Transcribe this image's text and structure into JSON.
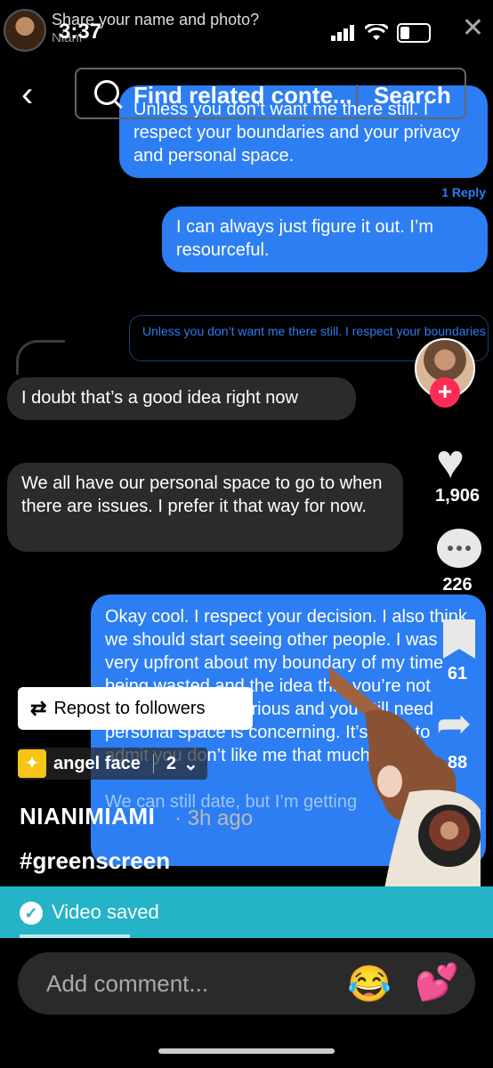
{
  "status": {
    "share_prompt": "Share your name and photo?",
    "name": "Niani",
    "time": "3:37",
    "close": "✕"
  },
  "search": {
    "back": "‹",
    "placeholder": "Find related conte...",
    "button": "Search"
  },
  "messages": {
    "m1": "Unless you don’t want me there still. I respect your boundaries and your privacy and personal space.",
    "reply_count": "1 Reply",
    "m2": "I can always just figure it out. I’m resourceful.",
    "quoted": "Unless you don’t want me there still. I respect your boundaries and your privacy and personal space.",
    "m3": "I doubt that’s a good idea right now",
    "m4": "We all have our personal space to go to when there are issues. I prefer it that way for now.",
    "m5": "Okay cool. I respect your decision. I also think we should start seeing other people. I was very upfront about my boundary of my time being wasted and the idea that you’re not really taking life serious and you still need personal space is concerning. It’s okay to admit you don’t like me that much.",
    "m6": "We can still date, but I’m getting"
  },
  "rail": {
    "follow": "+",
    "likes": "1,906",
    "comments": "226",
    "saves": "61",
    "shares": "88"
  },
  "overlay": {
    "repost_icon": "⇄",
    "repost": "Repost to followers",
    "effect_name": "angel face",
    "effect_count": "2",
    "chevron": "⌄",
    "username": "NIANIMIAMI",
    "time_ago": "· 3h ago",
    "hashtag": "#greenscreen"
  },
  "toast": {
    "check": "✓",
    "text": "Video saved",
    "progress": 0.25
  },
  "comment": {
    "placeholder": "Add comment...",
    "emoji1": "😂",
    "emoji2": "💕"
  },
  "colors": {
    "imessage_blue": "#2c7ef2",
    "gray_bubble": "#2b2b2d",
    "follow_red": "#fe2c55",
    "toast_teal": "#25b3c7"
  },
  "icons": [
    "search-icon",
    "back-icon",
    "heart-icon",
    "comment-icon",
    "bookmark-icon",
    "share-icon",
    "repost-icon",
    "check-icon"
  ]
}
